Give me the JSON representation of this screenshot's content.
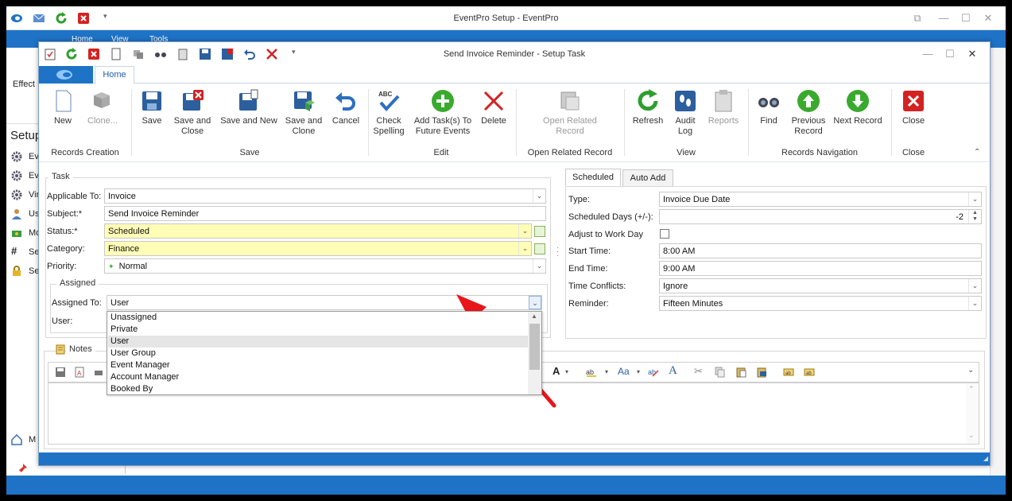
{
  "app": {
    "title": "EventPro Setup - EventPro",
    "tabs": [
      {
        "label": "Home"
      },
      {
        "label": "View"
      },
      {
        "label": "Tools"
      }
    ],
    "ribbon_label": "Effect",
    "side_title": "Setup",
    "side_items": [
      {
        "label": "Ev",
        "icon": "gear-icon"
      },
      {
        "label": "Ev",
        "icon": "gear-icon"
      },
      {
        "label": "Vir",
        "icon": "gear-icon"
      },
      {
        "label": "Us",
        "icon": "user-icon"
      },
      {
        "label": "Mo",
        "icon": "money-icon"
      },
      {
        "label": "Se",
        "icon": "hash-icon"
      },
      {
        "label": "Se",
        "icon": "lock-icon"
      }
    ],
    "bottom_item": "M"
  },
  "dialog": {
    "title": "Send Invoice Reminder - Setup Task",
    "home_tab": "Home",
    "ribbon": {
      "new": "New",
      "clone": "Clone...",
      "save": "Save",
      "save_and_close": "Save and Close",
      "save_and_new": "Save and New",
      "save_and_clone": "Save and Clone",
      "cancel": "Cancel",
      "check_spelling": "Check Spelling",
      "add_tasks": "Add Task(s) To Future Events",
      "delete": "Delete",
      "open_related_record": "Open Related Record",
      "refresh": "Refresh",
      "audit_log": "Audit Log",
      "reports": "Reports",
      "find": "Find",
      "previous_record": "Previous Record",
      "next_record": "Next Record",
      "close": "Close",
      "groups": {
        "records_creation": "Records Creation",
        "save": "Save",
        "edit": "Edit",
        "open_related_record": "Open Related Record",
        "view": "View",
        "records_navigation": "Records Navigation",
        "close": "Close"
      }
    },
    "task": {
      "legend": "Task",
      "applicable_to_label": "Applicable To:",
      "applicable_to": "Invoice",
      "subject_label": "Subject:*",
      "subject": "Send Invoice Reminder",
      "status_label": "Status:*",
      "status": "Scheduled",
      "category_label": "Category:",
      "category": "Finance",
      "priority_label": "Priority:",
      "priority": "Normal",
      "assigned_legend": "Assigned",
      "assigned_to_label": "Assigned To:",
      "assigned_to": "User",
      "user_label": "User:",
      "assigned_options": [
        "Unassigned",
        "Private",
        "User",
        "User Group",
        "Event Manager",
        "Account Manager",
        "Booked By"
      ],
      "selected_option_index": 2
    },
    "schedule": {
      "tabs": [
        {
          "label": "Scheduled"
        },
        {
          "label": "Auto Add"
        }
      ],
      "type_label": "Type:",
      "type": "Invoice Due Date",
      "days_label": "Scheduled Days (+/-):",
      "days": "-2",
      "adjust_label": "Adjust to Work Day",
      "adjust_checked": false,
      "start_label": "Start Time:",
      "start": "8:00 AM",
      "end_label": "End Time:",
      "end": "9:00 AM",
      "conflicts_label": "Time Conflicts:",
      "conflicts": "Ignore",
      "reminder_label": "Reminder:",
      "reminder": "Fifteen Minutes"
    },
    "notes_label": "Notes"
  },
  "colors": {
    "accent": "#1e73c6",
    "required_field": "#fffdb6",
    "arrow": "#e8151b"
  }
}
